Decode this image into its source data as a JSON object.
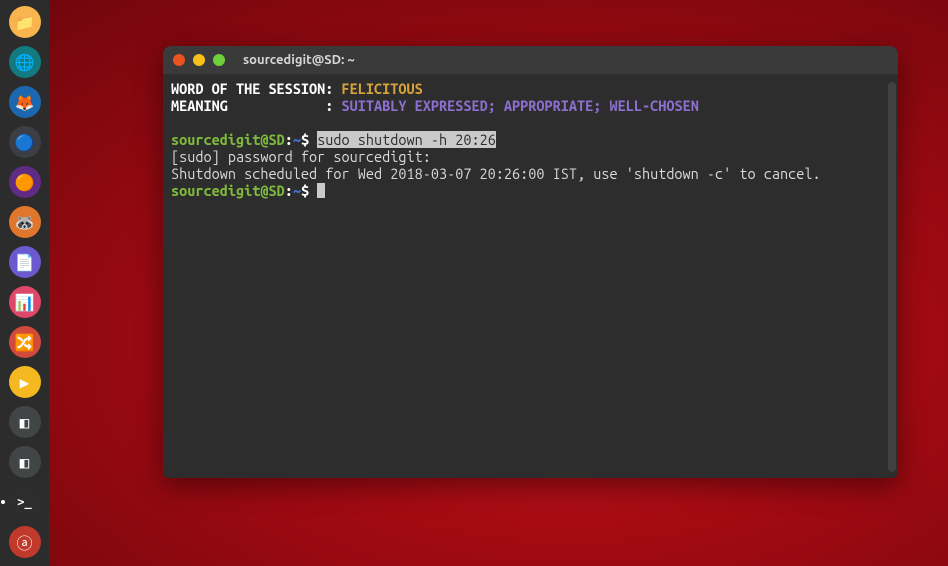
{
  "dock": {
    "items": [
      {
        "name": "files-icon",
        "bg": "#f9b44e",
        "emoji": "📁"
      },
      {
        "name": "web-browser-icon",
        "bg": "#137a7f",
        "emoji": "🌐"
      },
      {
        "name": "firefox-icon",
        "bg": "#1b67b0",
        "emoji": "🦊"
      },
      {
        "name": "chromium-icon",
        "bg": "#3b3f44",
        "emoji": "🔵"
      },
      {
        "name": "opera-icon",
        "bg": "#5f2b84",
        "emoji": "🟠"
      },
      {
        "name": "gimp-icon",
        "bg": "#e0762c",
        "emoji": "🦝"
      },
      {
        "name": "libreoffice-writer-icon",
        "bg": "#6a5acd",
        "emoji": "📄"
      },
      {
        "name": "libreoffice-impress-icon",
        "bg": "#e0466a",
        "emoji": "📊"
      },
      {
        "name": "settings-toggle-icon",
        "bg": "#d24a3a",
        "emoji": "🔀"
      },
      {
        "name": "media-player-icon",
        "bg": "#f5b820",
        "emoji": "▶"
      },
      {
        "name": "app-a-icon",
        "bg": "#414546",
        "emoji": "◧"
      },
      {
        "name": "app-b-icon",
        "bg": "#414546",
        "emoji": "◧"
      },
      {
        "name": "terminal-icon",
        "bg": "#2d2d2d",
        "emoji": ">_"
      },
      {
        "name": "amazon-icon",
        "bg": "#c1392b",
        "emoji": "ⓐ"
      }
    ]
  },
  "window": {
    "title": "sourcedigit@SD: ~"
  },
  "terminal": {
    "label_word": "WORD OF THE SESSION: ",
    "word": "FELICITOUS",
    "label_meaning": "MEANING            : ",
    "meaning": "SUITABLY EXPRESSED; APPROPRIATE; WELL-CHOSEN",
    "prompt_user": "sourcedigit@SD",
    "prompt_colon": ":",
    "prompt_path": "~",
    "prompt_dollar": "$ ",
    "cmd1_selected": "sudo shutdown -h 20:26",
    "line_sudo": "[sudo] password for sourcedigit: ",
    "line_sched": "Shutdown scheduled for Wed 2018-03-07 20:26:00 IST, use 'shutdown -c' to cancel."
  }
}
